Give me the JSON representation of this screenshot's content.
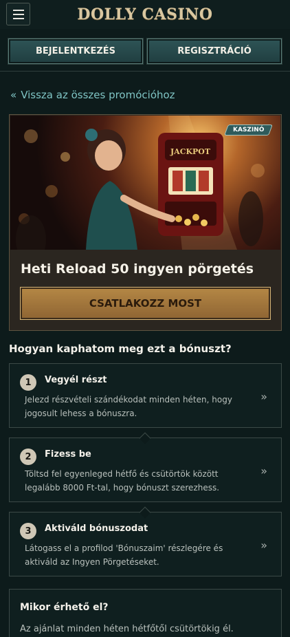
{
  "header": {
    "logo": "DOLLY CASINO",
    "menu_icon": "hamburger-icon"
  },
  "auth": {
    "login_label": "BEJELENTKEZÉS",
    "register_label": "REGISZTRÁCIÓ"
  },
  "back": {
    "label": "Vissza az összes promócióhoz",
    "icon": "double-chevron-left-icon"
  },
  "promo": {
    "badge": "KASZINÓ",
    "title": "Heti Reload 50 ingyen pörgetés",
    "cta": "CSATLAKOZZ MOST"
  },
  "how": {
    "title": "Hogyan kaphatom meg ezt a bónuszt?",
    "steps": [
      {
        "number": "1",
        "title": "Vegyél részt",
        "text": "Jelezd részvételi szándékodat minden héten, hogy jogosult lehess a bónuszra."
      },
      {
        "number": "2",
        "title": "Fizess be",
        "text": "Töltsd fel egyenleged hétfő és csütörtök között legalább 8000 Ft-tal, hogy bónuszt szerezhess."
      },
      {
        "number": "3",
        "title": "Aktiváld bónuszodat",
        "text": "Látogass el a profilod 'Bónuszaim' részlegére és aktiváld az Ingyen Pörgetéseket."
      }
    ]
  },
  "when": {
    "title": "Mikor érhető el?",
    "text": "Az ajánlat minden héten hétfőtől csütörtökig él."
  },
  "colors": {
    "background": "#0d1b1b",
    "accent_teal": "#2f5b5b",
    "gold": "#b58845",
    "link": "#7fc4c4"
  }
}
